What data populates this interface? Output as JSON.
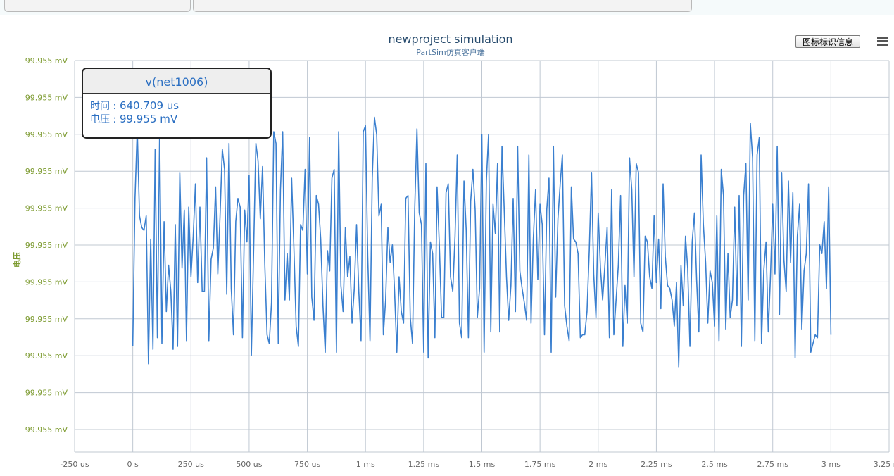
{
  "chart_data": {
    "type": "line",
    "title": "newproject simulation",
    "subtitle": "PartSim仿真客户端",
    "ylabel": "电压",
    "xlabel": "",
    "x_ticks": [
      "-250 us",
      "0 s",
      "250 us",
      "500 us",
      "750 us",
      "1 ms",
      "1.25 ms",
      "1.5 ms",
      "1.75 ms",
      "2 ms",
      "2.25 ms",
      "2.5 ms",
      "2.75 ms",
      "3 ms",
      "3.25 ms"
    ],
    "y_ticks": [
      "99.955 mV",
      "99.955 mV",
      "99.955 mV",
      "99.955 mV",
      "99.955 mV",
      "99.955 mV",
      "99.955 mV",
      "99.955 mV",
      "99.955 mV",
      "99.955 mV",
      "99.955 mV"
    ],
    "xlim_us": [
      -250,
      3250
    ],
    "ylim": [
      0,
      1
    ],
    "grid": true,
    "series": [
      {
        "name": "v(net1006)",
        "color": "#3a7fcf",
        "x_start_us": 0,
        "x_end_us": 3000,
        "values": [
          0.17,
          0.68,
          0.92,
          0.62,
          0.58,
          0.57,
          0.62,
          0.11,
          0.54,
          0.16,
          0.85,
          0.2,
          0.91,
          0.18,
          0.6,
          0.29,
          0.45,
          0.36,
          0.16,
          0.59,
          0.17,
          0.77,
          0.44,
          0.64,
          0.19,
          0.65,
          0.41,
          0.55,
          0.73,
          0.39,
          0.65,
          0.36,
          0.36,
          0.82,
          0.19,
          0.47,
          0.51,
          0.72,
          0.42,
          0.62,
          0.85,
          0.78,
          0.35,
          0.87,
          0.37,
          0.21,
          0.6,
          0.68,
          0.65,
          0.2,
          0.64,
          0.53,
          0.76,
          0.14,
          0.5,
          0.87,
          0.81,
          0.61,
          0.79,
          0.45,
          0.21,
          0.18,
          0.32,
          0.91,
          0.87,
          0.18,
          0.71,
          0.91,
          0.33,
          0.49,
          0.33,
          0.75,
          0.51,
          0.24,
          0.17,
          0.59,
          0.57,
          0.78,
          0.42,
          0.89,
          0.34,
          0.26,
          0.69,
          0.66,
          0.54,
          0.31,
          0.15,
          0.5,
          0.43,
          0.75,
          0.78,
          0.15,
          0.91,
          0.38,
          0.29,
          0.58,
          0.41,
          0.48,
          0.25,
          0.37,
          0.59,
          0.36,
          0.19,
          0.91,
          0.93,
          0.48,
          0.19,
          0.75,
          0.96,
          0.9,
          0.62,
          0.66,
          0.21,
          0.33,
          0.58,
          0.46,
          0.52,
          0.36,
          0.15,
          0.41,
          0.29,
          0.25,
          0.68,
          0.69,
          0.27,
          0.18,
          0.64,
          0.92,
          0.63,
          0.59,
          0.15,
          0.8,
          0.13,
          0.53,
          0.49,
          0.2,
          0.72,
          0.52,
          0.27,
          0.27,
          0.7,
          0.73,
          0.41,
          0.36,
          0.55,
          0.83,
          0.25,
          0.2,
          0.74,
          0.57,
          0.2,
          0.67,
          0.78,
          0.64,
          0.27,
          0.37,
          0.9,
          0.15,
          0.74,
          0.9,
          0.22,
          0.66,
          0.56,
          0.8,
          0.22,
          0.86,
          0.64,
          0.41,
          0.26,
          0.38,
          0.68,
          0.29,
          0.86,
          0.43,
          0.37,
          0.32,
          0.26,
          0.83,
          0.25,
          0.54,
          0.71,
          0.4,
          0.66,
          0.59,
          0.21,
          0.64,
          0.75,
          0.15,
          0.86,
          0.34,
          0.61,
          0.73,
          0.83,
          0.31,
          0.24,
          0.19,
          0.72,
          0.54,
          0.53,
          0.49,
          0.2,
          0.21,
          0.21,
          0.29,
          0.5,
          0.77,
          0.42,
          0.27,
          0.63,
          0.44,
          0.33,
          0.45,
          0.58,
          0.2,
          0.71,
          0.21,
          0.33,
          0.45,
          0.69,
          0.17,
          0.38,
          0.25,
          0.82,
          0.71,
          0.41,
          0.8,
          0.77,
          0.25,
          0.22,
          0.55,
          0.53,
          0.41,
          0.37,
          0.62,
          0.39,
          0.54,
          0.3,
          0.73,
          0.48,
          0.38,
          0.37,
          0.33,
          0.24,
          0.39,
          0.1,
          0.45,
          0.31,
          0.55,
          0.44,
          0.17,
          0.53,
          0.63,
          0.4,
          0.22,
          0.83,
          0.59,
          0.46,
          0.25,
          0.43,
          0.39,
          0.24,
          0.62,
          0.19,
          0.78,
          0.69,
          0.23,
          0.49,
          0.27,
          0.33,
          0.65,
          0.31,
          0.69,
          0.17,
          0.69,
          0.8,
          0.33,
          0.94,
          0.82,
          0.19,
          0.83,
          0.89,
          0.18,
          0.43,
          0.53,
          0.22,
          0.41,
          0.66,
          0.42,
          0.86,
          0.28,
          0.77,
          0.47,
          0.36,
          0.74,
          0.46,
          0.7,
          0.13,
          0.55,
          0.66,
          0.23,
          0.43,
          0.49,
          0.73,
          0.15,
          0.18,
          0.21,
          0.2,
          0.52,
          0.49,
          0.6,
          0.37,
          0.72,
          0.21
        ]
      }
    ]
  },
  "tooltip": {
    "series_name": "v(net1006)",
    "time_label": "时间 :",
    "time_value": "640.709 us",
    "volt_label": "电压 :",
    "volt_value": "99.955 mV"
  },
  "toolbar": {
    "legend_button_label": "图标标识信息",
    "menu_icon": "hamburger-menu-icon"
  },
  "colors": {
    "grid": "#c0c8d2",
    "y_tick_text": "#7c9a2f",
    "x_tick_text": "#666666",
    "series": "#3a7fcf"
  }
}
